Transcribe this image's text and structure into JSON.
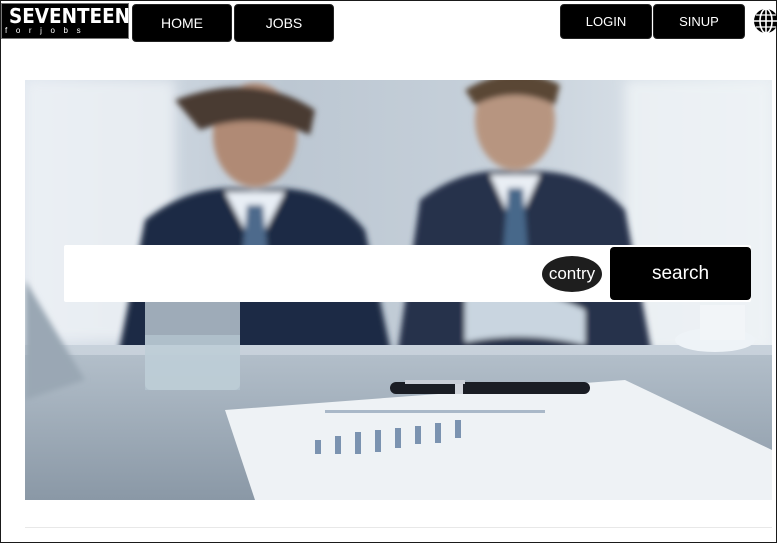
{
  "logo": {
    "main": "SEVENTEEN",
    "sub": "forjobs"
  },
  "nav": {
    "home_label": "HOME",
    "jobs_label": "JOBS",
    "login_label": "LOGIN",
    "signup_label": "SINUP"
  },
  "icons": {
    "language": "globe-icon"
  },
  "hero": {
    "image": "business-meeting-photo"
  },
  "search": {
    "input_value": "",
    "country_label": "contry",
    "button_label": "search"
  },
  "colors": {
    "button_bg": "#000000",
    "button_text": "#ffffff",
    "country_bg": "#1e1e1e"
  }
}
